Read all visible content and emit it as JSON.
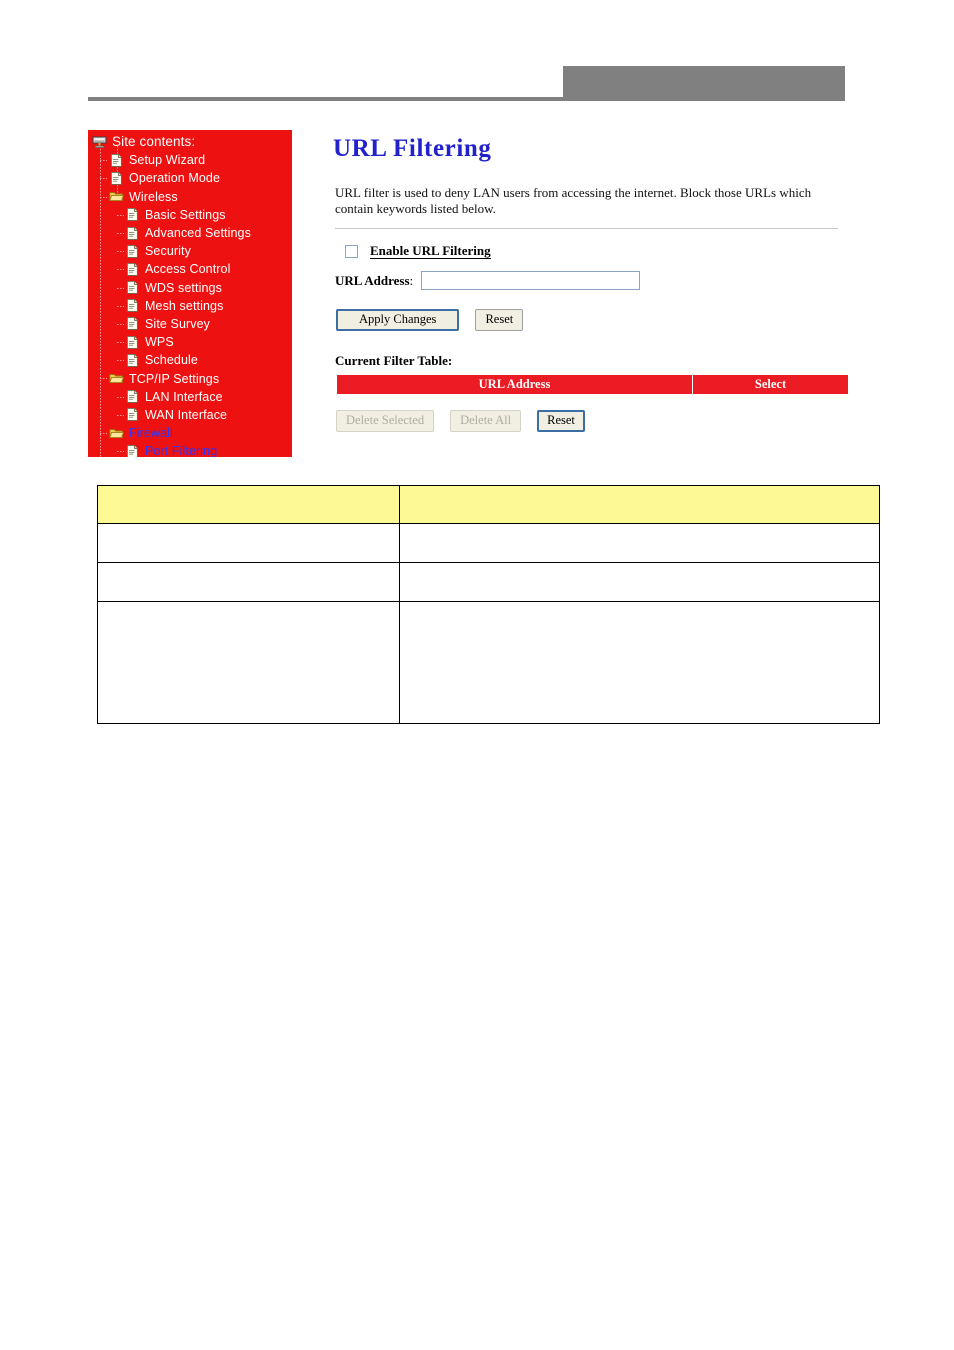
{
  "header": {
    "band_color": "#808080",
    "rule_color": "#808080"
  },
  "sidebar": {
    "background_color": "#ee1111",
    "root": {
      "label": "Site contents:",
      "icon": "computer-icon"
    },
    "items": [
      {
        "label": "Setup Wizard",
        "icon": "page-icon",
        "level": 1,
        "active": false
      },
      {
        "label": "Operation Mode",
        "icon": "page-icon",
        "level": 1,
        "active": false
      },
      {
        "label": "Wireless",
        "icon": "folder-icon",
        "level": 1,
        "active": false
      },
      {
        "label": "Basic Settings",
        "icon": "page-icon",
        "level": 2,
        "active": false
      },
      {
        "label": "Advanced Settings",
        "icon": "page-icon",
        "level": 2,
        "active": false
      },
      {
        "label": "Security",
        "icon": "page-icon",
        "level": 2,
        "active": false
      },
      {
        "label": "Access Control",
        "icon": "page-icon",
        "level": 2,
        "active": false
      },
      {
        "label": "WDS settings",
        "icon": "page-icon",
        "level": 2,
        "active": false
      },
      {
        "label": "Mesh settings",
        "icon": "page-icon",
        "level": 2,
        "active": false
      },
      {
        "label": "Site Survey",
        "icon": "page-icon",
        "level": 2,
        "active": false
      },
      {
        "label": "WPS",
        "icon": "page-icon",
        "level": 2,
        "active": false
      },
      {
        "label": "Schedule",
        "icon": "page-icon",
        "level": 2,
        "active": false
      },
      {
        "label": "TCP/IP Settings",
        "icon": "folder-icon",
        "level": 1,
        "active": false
      },
      {
        "label": "LAN Interface",
        "icon": "page-icon",
        "level": 2,
        "active": false
      },
      {
        "label": "WAN Interface",
        "icon": "page-icon",
        "level": 2,
        "active": false
      },
      {
        "label": "Firewall",
        "icon": "folder-icon",
        "level": 1,
        "active": true
      },
      {
        "label": "Port Filtering",
        "icon": "page-icon",
        "level": 2,
        "active": true
      }
    ],
    "active_color": "#3333ee",
    "label_color": "#ffffff"
  },
  "main": {
    "title": "URL Filtering",
    "title_color": "#2222cc",
    "description": "URL filter is used to deny LAN users from accessing the internet. Block those URLs which contain keywords listed below.",
    "enable_checkbox": {
      "label": "Enable URL Filtering",
      "checked": false
    },
    "url_address": {
      "label": "URL Address",
      "colon": ":",
      "value": "",
      "placeholder": ""
    },
    "primary_buttons": [
      {
        "label": "Apply Changes",
        "state": "focused",
        "wide": true
      },
      {
        "label": "Reset",
        "state": "enabled",
        "wide": false
      }
    ],
    "filter_table": {
      "caption": "Current Filter Table:",
      "header_color": "#ec1c24",
      "columns": [
        "URL Address",
        "Select"
      ],
      "rows": []
    },
    "table_buttons": [
      {
        "label": "Delete Selected",
        "state": "disabled",
        "wide": false
      },
      {
        "label": "Delete All",
        "state": "disabled",
        "wide": false
      },
      {
        "label": "Reset",
        "state": "focused",
        "wide": false
      }
    ]
  },
  "doc_table": {
    "header_color": "#fdfa96",
    "header": [
      "",
      ""
    ],
    "rows": [
      [
        "",
        ""
      ],
      [
        "",
        ""
      ],
      [
        "",
        ""
      ]
    ]
  }
}
